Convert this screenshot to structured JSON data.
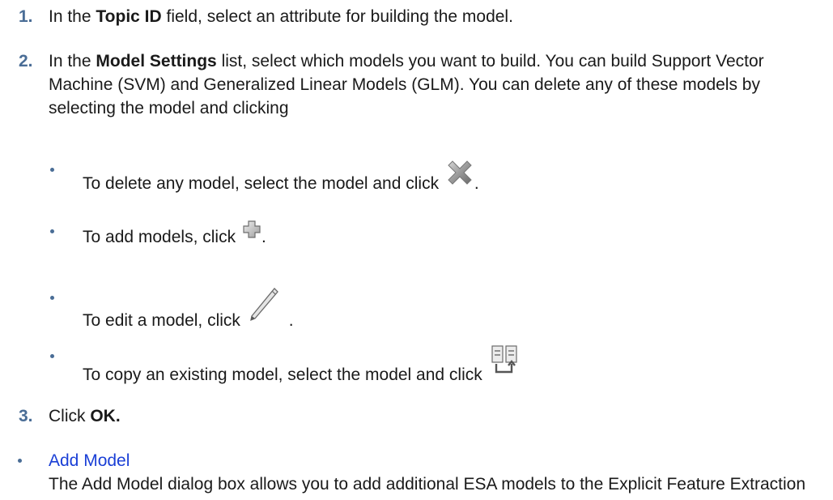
{
  "steps": [
    {
      "number": "1.",
      "pre": "In the ",
      "bold": "Topic ID",
      "post": " field, select an attribute for building the model."
    },
    {
      "number": "2.",
      "pre": "In the ",
      "bold": "Model Settings",
      "post": " list, select which models you want to build. You can build Support Vector Machine (SVM) and Generalized Linear Models (GLM). You can delete any of these models by selecting the model and clicking"
    },
    {
      "number": "3.",
      "pre": "Click ",
      "bold": "OK."
    }
  ],
  "bullets": [
    {
      "text": "To delete any model, select the model and click",
      "icon": "delete-x-icon",
      "suffix": "."
    },
    {
      "text": "To add models, click",
      "icon": "add-plus-icon",
      "suffix": "."
    },
    {
      "text": "To edit a model, click",
      "icon": "pencil-edit-icon",
      "suffix": "."
    },
    {
      "text": "To copy an existing model, select the model and click",
      "icon": "copy-model-icon",
      "suffix": ""
    }
  ],
  "related": {
    "link_text": "Add Model",
    "description": "The Add Model dialog box allows you to add additional ESA models to the Explicit Feature Extraction node."
  },
  "colors": {
    "step_number": "#4a6d96",
    "link": "#1a3fd6",
    "text": "#1a1a1a"
  }
}
